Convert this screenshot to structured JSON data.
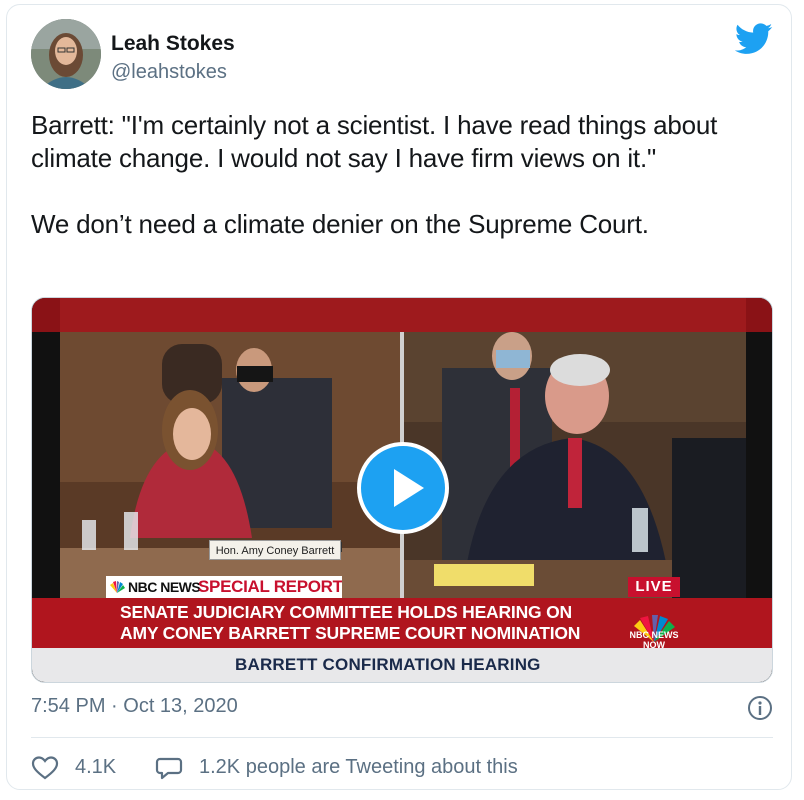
{
  "author": {
    "name": "Leah Stokes",
    "handle": "@leahstokes"
  },
  "tweet": {
    "line1": "Barrett: \"I'm certainly not a scientist. I have read things about climate change. I would not say I have firm views on it.\"",
    "line2": "We don’t need a climate denier on the Supreme Court."
  },
  "video": {
    "nameplate": "Hon. Amy Coney Barrett",
    "network": "NBC NEWS",
    "special_report": "SPECIAL REPORT",
    "live_label": "LIVE",
    "headline_1": "SENATE JUDICIARY COMMITTEE HOLDS HEARING ON",
    "headline_2": "AMY CONEY BARRETT SUPREME COURT NOMINATION",
    "corner_logo_1": "NBC NEWS",
    "corner_logo_2": "NOW",
    "lower_bar": "BARRETT CONFIRMATION HEARING"
  },
  "meta": {
    "timestamp": "7:54 PM · Oct 13, 2020",
    "likes": "4.1K",
    "replies": "1.2K people are Tweeting about this"
  },
  "icons": {
    "brand": "twitter-bird-icon",
    "info": "info-icon",
    "like": "heart-icon",
    "reply": "speech-bubble-icon",
    "play": "play-icon"
  },
  "colors": {
    "twitter_blue": "#1da1f2",
    "nbc_red": "#c8102e",
    "secondary_text": "#5b7083"
  }
}
